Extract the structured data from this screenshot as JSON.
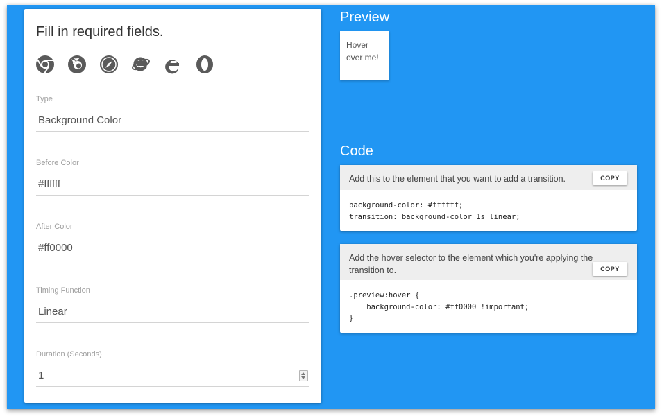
{
  "form": {
    "title": "Fill in required fields.",
    "browser_icons": [
      "chrome-icon",
      "firefox-icon",
      "safari-icon",
      "internet-explorer-icon",
      "edge-icon",
      "opera-icon"
    ],
    "fields": {
      "type": {
        "label": "Type",
        "value": "Background Color"
      },
      "before_color": {
        "label": "Before Color",
        "value": "#ffffff"
      },
      "after_color": {
        "label": "After Color",
        "value": "#ff0000"
      },
      "timing_function": {
        "label": "Timing Function",
        "value": "Linear"
      },
      "duration": {
        "label": "Duration (Seconds)",
        "value": "1"
      }
    }
  },
  "preview": {
    "heading": "Preview",
    "box_text": "Hover over me!"
  },
  "code": {
    "heading": "Code",
    "cards": [
      {
        "description": "Add this to the element that you want to add a transition.",
        "copy_label": "COPY",
        "code": "background-color: #ffffff;\ntransition: background-color 1s linear;"
      },
      {
        "description": "Add the hover selector to the element which you're applying the transition to.",
        "copy_label": "COPY",
        "code": ".preview:hover {\n    background-color: #ff0000 !important;\n}"
      }
    ]
  },
  "colors": {
    "background": "#2196f3",
    "card": "#ffffff",
    "card_header": "#eeeeee"
  }
}
